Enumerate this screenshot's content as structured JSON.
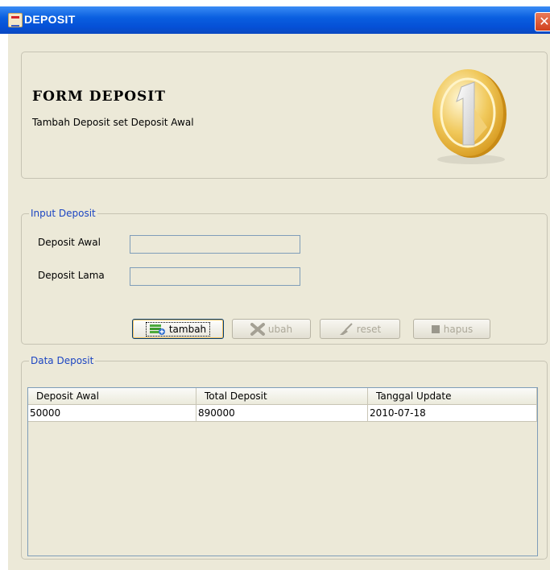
{
  "window": {
    "title": "DEPOSIT",
    "close_label": "✕"
  },
  "header": {
    "title": "FORM DEPOSIT",
    "subtitle": "Tambah Deposit set Deposit Awal"
  },
  "input_section": {
    "legend": "Input Deposit",
    "deposit_awal_label": "Deposit Awal",
    "deposit_awal_value": "",
    "deposit_lama_label": "Deposit Lama",
    "deposit_lama_value": ""
  },
  "buttons": {
    "tambah": "tambah",
    "ubah": "ubah",
    "reset": "reset",
    "hapus": "hapus"
  },
  "data_section": {
    "legend": "Data Deposit",
    "columns": [
      "Deposit Awal",
      "Total Deposit",
      "Tanggal Update"
    ],
    "rows": [
      [
        "50000",
        "890000",
        "2010-07-18"
      ]
    ]
  },
  "colors": {
    "titlebar": "#0a5fe0",
    "legend_text": "#1c45c2",
    "panel_bg": "#ece9d8"
  }
}
